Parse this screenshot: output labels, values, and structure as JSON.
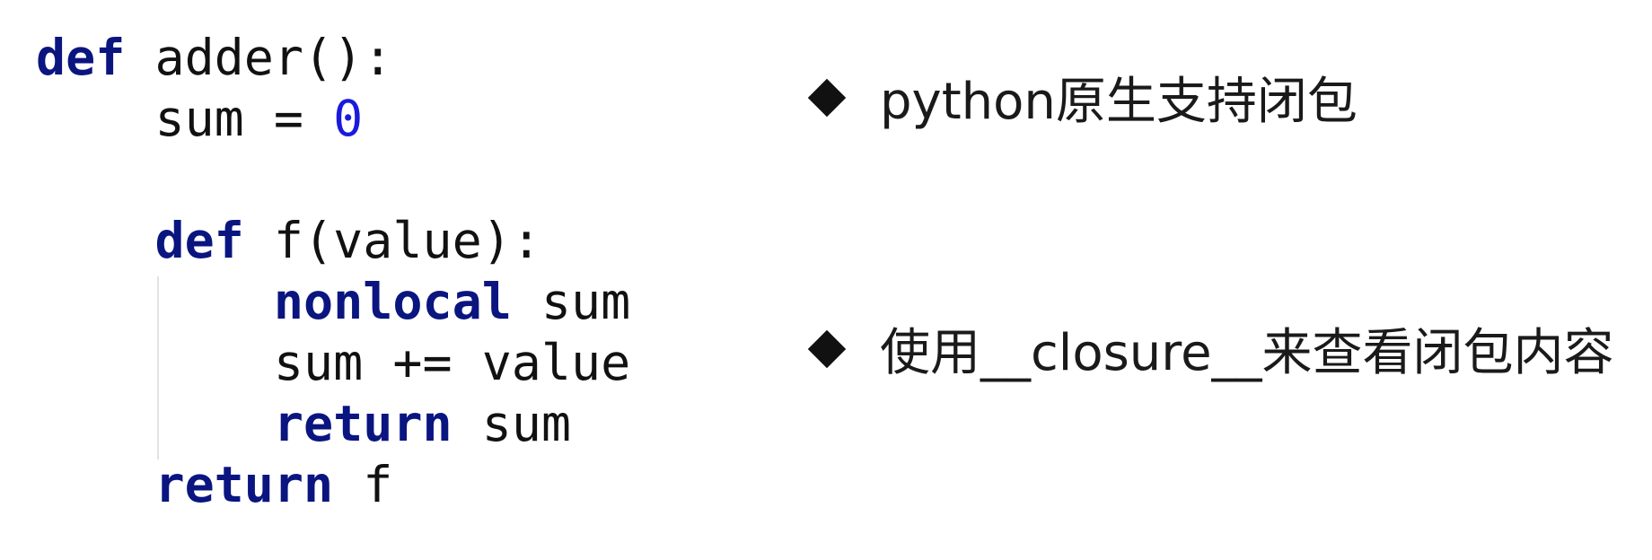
{
  "code": {
    "lines": [
      [
        {
          "t": "def",
          "c": "kw"
        },
        {
          "t": " adder():",
          "c": ""
        }
      ],
      [
        {
          "t": "    sum = ",
          "c": ""
        },
        {
          "t": "0",
          "c": "num"
        }
      ],
      [],
      [
        {
          "t": "    ",
          "c": ""
        },
        {
          "t": "def",
          "c": "kw"
        },
        {
          "t": " f(value):",
          "c": ""
        }
      ],
      [
        {
          "t": "        ",
          "c": ""
        },
        {
          "t": "nonlocal",
          "c": "kw"
        },
        {
          "t": " sum",
          "c": ""
        }
      ],
      [
        {
          "t": "        sum += value",
          "c": ""
        }
      ],
      [
        {
          "t": "        ",
          "c": ""
        },
        {
          "t": "return",
          "c": "kw"
        },
        {
          "t": " sum",
          "c": ""
        }
      ],
      [
        {
          "t": "    ",
          "c": ""
        },
        {
          "t": "return",
          "c": "kw"
        },
        {
          "t": " f",
          "c": ""
        }
      ]
    ],
    "colors": {
      "keyword": "#0a1580",
      "number": "#1a1adc",
      "text": "#111111"
    }
  },
  "bullets": {
    "items": [
      {
        "icon": "diamond-bullet-icon",
        "text": "python原生支持闭包"
      },
      {
        "icon": "diamond-bullet-icon",
        "text": "使用__closure__来查看闭包内容"
      }
    ]
  }
}
